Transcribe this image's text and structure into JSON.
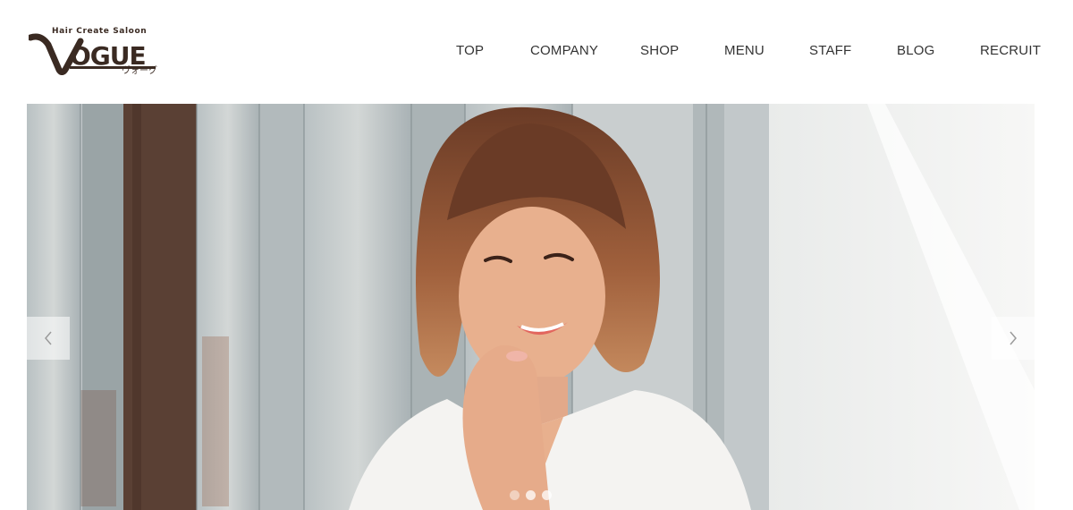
{
  "header": {
    "logo": {
      "tagline": "Hair Create Saloon",
      "name": "VOGUE",
      "kana": "ヴォーグ"
    },
    "nav": [
      {
        "label": "TOP"
      },
      {
        "label": "COMPANY"
      },
      {
        "label": "SHOP"
      },
      {
        "label": "MENU"
      },
      {
        "label": "STAFF"
      },
      {
        "label": "BLOG"
      },
      {
        "label": "RECRUIT"
      }
    ]
  },
  "slider": {
    "prev_icon": "chevron-left-icon",
    "next_icon": "chevron-right-icon",
    "slide_count": 3,
    "active_index": 0
  },
  "colors": {
    "brand": "#3a2a22",
    "nav_text": "#333333",
    "wood_dark": "#5a4034",
    "wall_light": "#f1f1ef"
  }
}
